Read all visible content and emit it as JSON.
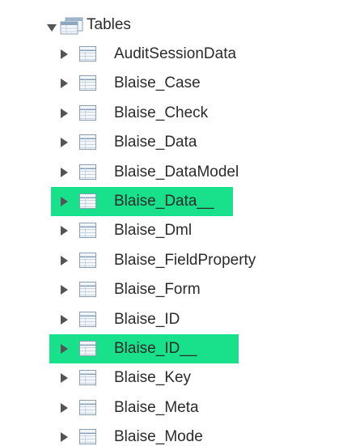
{
  "tree": {
    "root": {
      "label": "Tables",
      "expanded": true
    },
    "items": [
      {
        "label": "AuditSessionData",
        "highlighted": false
      },
      {
        "label": "Blaise_Case",
        "highlighted": false
      },
      {
        "label": "Blaise_Check",
        "highlighted": false
      },
      {
        "label": "Blaise_Data",
        "highlighted": false
      },
      {
        "label": "Blaise_DataModel",
        "highlighted": false
      },
      {
        "label": "Blaise_Data__",
        "highlighted": true
      },
      {
        "label": "Blaise_Dml",
        "highlighted": false
      },
      {
        "label": "Blaise_FieldProperty",
        "highlighted": false
      },
      {
        "label": "Blaise_Form",
        "highlighted": false
      },
      {
        "label": "Blaise_ID",
        "highlighted": false
      },
      {
        "label": "Blaise_ID__",
        "highlighted": true
      },
      {
        "label": "Blaise_Key",
        "highlighted": false
      },
      {
        "label": "Blaise_Meta",
        "highlighted": false
      },
      {
        "label": "Blaise_Mode",
        "highlighted": false
      }
    ]
  },
  "colors": {
    "highlight": "#19e08a",
    "arrow": "#545454",
    "text": "#2b2b2b"
  },
  "icons": {
    "root_toggle": "expanded-arrow-icon",
    "root": "tables-folder-icon",
    "item_toggle": "collapsed-arrow-icon",
    "item": "table-icon"
  }
}
